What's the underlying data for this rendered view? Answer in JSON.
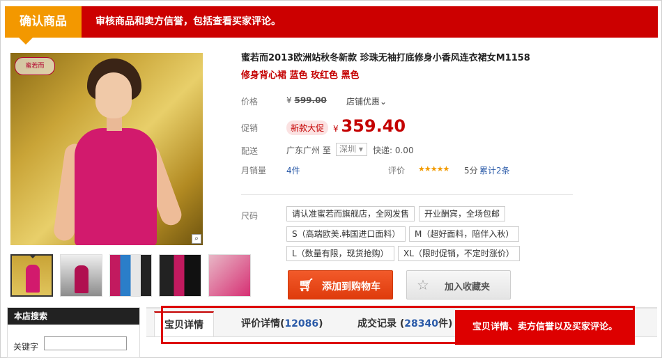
{
  "banner": {
    "tag": "确认商品",
    "text": "审核商品和卖方信誉，包括查看买家评论。"
  },
  "product": {
    "logo": "蜜若而",
    "title_line1": "蜜若而2013欧洲站秋冬新款 珍珠无袖打底修身小香风连衣裙女M1158",
    "title_line2": "修身背心裙 蓝色 玫红色 黑色"
  },
  "price": {
    "label": "价格",
    "currency": "¥",
    "original": "599.00",
    "discount_label": "店铺优惠",
    "promo_label": "促销",
    "promo_badge": "新款大促",
    "promo_value": "359.40"
  },
  "shipping": {
    "label": "配送",
    "from": "广东广州 至",
    "to_city": "深圳",
    "fee": "快递: 0.00"
  },
  "sales": {
    "monthly_label": "月销量",
    "monthly_value": "4件",
    "rating_label": "评价",
    "stars": "★★★★★",
    "score": "5分",
    "total_reviews": "累计2条"
  },
  "sizes": {
    "label": "尺码",
    "options": [
      "请认准蜜若而旗舰店，全网发售",
      "开业酬宾，全场包邮",
      "S（高端欧美.韩国进口面料）",
      "M（超好面料，陪伴入秋）",
      "L（数量有限，现货抢购）",
      "XL（限时促销，不定时涨价）"
    ]
  },
  "actions": {
    "add_to_cart": "添加到购物车",
    "add_to_favorites": "加入收藏夹",
    "cart_icon": "cart-icon",
    "star_icon": "star-icon"
  },
  "shop_search": {
    "title": "本店搜索",
    "keyword_label": "关键字",
    "keyword_value": ""
  },
  "tabs": [
    {
      "label": "宝贝详情",
      "count": ""
    },
    {
      "label": "评价详情(",
      "count": "12086",
      "suffix": ")"
    },
    {
      "label": "成交记录 (",
      "count": "28340",
      "suffix": "件)"
    }
  ],
  "callout": "宝贝详情、卖方信誉以及买家评论。"
}
